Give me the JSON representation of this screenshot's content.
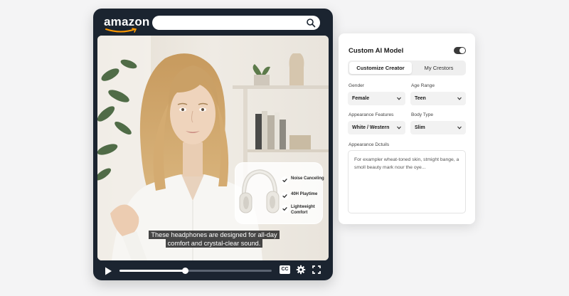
{
  "player": {
    "logo": "amazon",
    "search": {
      "value": "",
      "placeholder": ""
    },
    "product_card": {
      "features": [
        "Noise Canceling",
        "40H Playtime",
        "Lightweight Comfort"
      ]
    },
    "caption": "These headphones are designed for all-day comfort and crystal-clear sound.",
    "progress": 0.43,
    "cc_label": "CC"
  },
  "panel": {
    "title": "Custom AI Model",
    "toggle_on": true,
    "tabs": [
      "Customize Creator",
      "My Crestors"
    ],
    "active_tab": 0,
    "fields": {
      "gender": {
        "label": "Gender",
        "value": "Female"
      },
      "age_range": {
        "label": "Age Range",
        "value": "Teen"
      },
      "appearance_features": {
        "label": "Appearance Features",
        "value": "White / Western"
      },
      "body_type": {
        "label": "Body Type",
        "value": "Slim"
      }
    },
    "details": {
      "label": "Appearance Dctuils",
      "value": "For exampler wheat-toned skin, stmight bange, a smoll beauty mark nour the oye..."
    }
  },
  "colors": {
    "page_bg": "#f4f4f5",
    "player_bg": "#1b2430",
    "accent_orange": "#ff9900"
  }
}
